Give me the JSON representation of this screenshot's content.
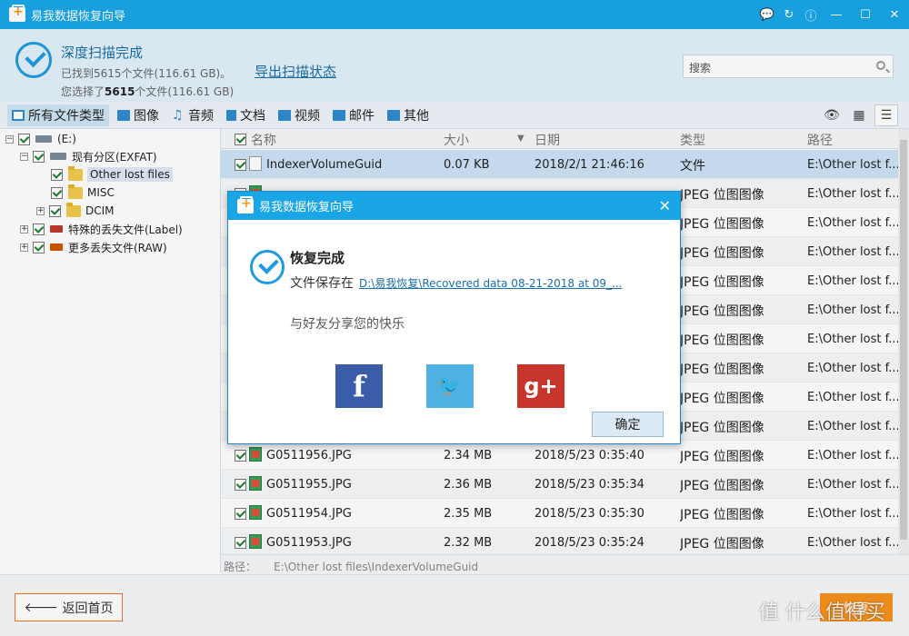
{
  "window": {
    "title": "易我数据恢复向导"
  },
  "status": {
    "title": "深度扫描完成",
    "found_text": "已找到5615个文件(116.61 GB)。",
    "selected_prefix": "您选择了",
    "selected_count": "5615",
    "selected_suffix": "个文件(116.61 GB)",
    "export_link": "导出扫描状态",
    "search_placeholder": "搜索"
  },
  "filters": [
    {
      "label": "所有文件类型",
      "icon": "monitor-icon",
      "color": "#2e8bd0"
    },
    {
      "label": "图像",
      "icon": "image-icon",
      "color": "#2e8bd0"
    },
    {
      "label": "音频",
      "icon": "music-icon",
      "color": "#2e8bd0"
    },
    {
      "label": "文档",
      "icon": "document-icon",
      "color": "#2e8bd0"
    },
    {
      "label": "视频",
      "icon": "video-icon",
      "color": "#2e8bd0"
    },
    {
      "label": "邮件",
      "icon": "mail-icon",
      "color": "#2e8bd0"
    },
    {
      "label": "其他",
      "icon": "folder-icon",
      "color": "#2e8bd0"
    }
  ],
  "tree": {
    "root": "(E:)",
    "partition": "现有分区(EXFAT)",
    "folders": [
      "Other lost files",
      "MISC",
      "DCIM"
    ],
    "label_node": "特殊的丢失文件(Label)",
    "raw_node": "更多丢失文件(RAW)"
  },
  "columns": {
    "name": "名称",
    "size": "大小",
    "date": "日期",
    "type": "类型",
    "path": "路径"
  },
  "rows": [
    {
      "name": "IndexerVolumeGuid",
      "size": "0.07 KB",
      "date": "2018/2/1 21:46:16",
      "type": "文件",
      "path": "E:\\Other lost f..."
    },
    {
      "name": "",
      "size": "",
      "date": "",
      "type": "JPEG 位图图像",
      "path": "E:\\Other lost f..."
    },
    {
      "name": "",
      "size": "",
      "date": "",
      "type": "JPEG 位图图像",
      "path": "E:\\Other lost f..."
    },
    {
      "name": "",
      "size": "",
      "date": "",
      "type": "JPEG 位图图像",
      "path": "E:\\Other lost f..."
    },
    {
      "name": "",
      "size": "",
      "date": "",
      "type": "JPEG 位图图像",
      "path": "E:\\Other lost f..."
    },
    {
      "name": "",
      "size": "",
      "date": "",
      "type": "JPEG 位图图像",
      "path": "E:\\Other lost f..."
    },
    {
      "name": "",
      "size": "",
      "date": "",
      "type": "JPEG 位图图像",
      "path": "E:\\Other lost f..."
    },
    {
      "name": "",
      "size": "",
      "date": "",
      "type": "JPEG 位图图像",
      "path": "E:\\Other lost f..."
    },
    {
      "name": "",
      "size": "",
      "date": "",
      "type": "JPEG 位图图像",
      "path": "E:\\Other lost f..."
    },
    {
      "name": "",
      "size": "",
      "date": "",
      "type": "JPEG 位图图像",
      "path": "E:\\Other lost f..."
    },
    {
      "name": "G0511956.JPG",
      "size": "2.34 MB",
      "date": "2018/5/23 0:35:40",
      "type": "JPEG 位图图像",
      "path": "E:\\Other lost f..."
    },
    {
      "name": "G0511955.JPG",
      "size": "2.36 MB",
      "date": "2018/5/23 0:35:34",
      "type": "JPEG 位图图像",
      "path": "E:\\Other lost f..."
    },
    {
      "name": "G0511954.JPG",
      "size": "2.35 MB",
      "date": "2018/5/23 0:35:30",
      "type": "JPEG 位图图像",
      "path": "E:\\Other lost f..."
    },
    {
      "name": "G0511953.JPG",
      "size": "2.32 MB",
      "date": "2018/5/23 0:35:24",
      "type": "JPEG 位图图像",
      "path": "E:\\Other lost f..."
    }
  ],
  "pathbar": {
    "label": "路径：",
    "value": "E:\\Other lost files\\IndexerVolumeGuid"
  },
  "bottom": {
    "back": "返回首页",
    "recover": "恢复"
  },
  "dialog": {
    "title": "易我数据恢复向导",
    "heading": "恢复完成",
    "save_label": "文件保存在",
    "save_path": "D:\\易我恢复\\Recovered data 08-21-2018 at 09_...",
    "share_text": "与好友分享您的快乐",
    "facebook": "f",
    "google": "g+",
    "ok": "确定"
  },
  "watermark": "值 什么值得买"
}
